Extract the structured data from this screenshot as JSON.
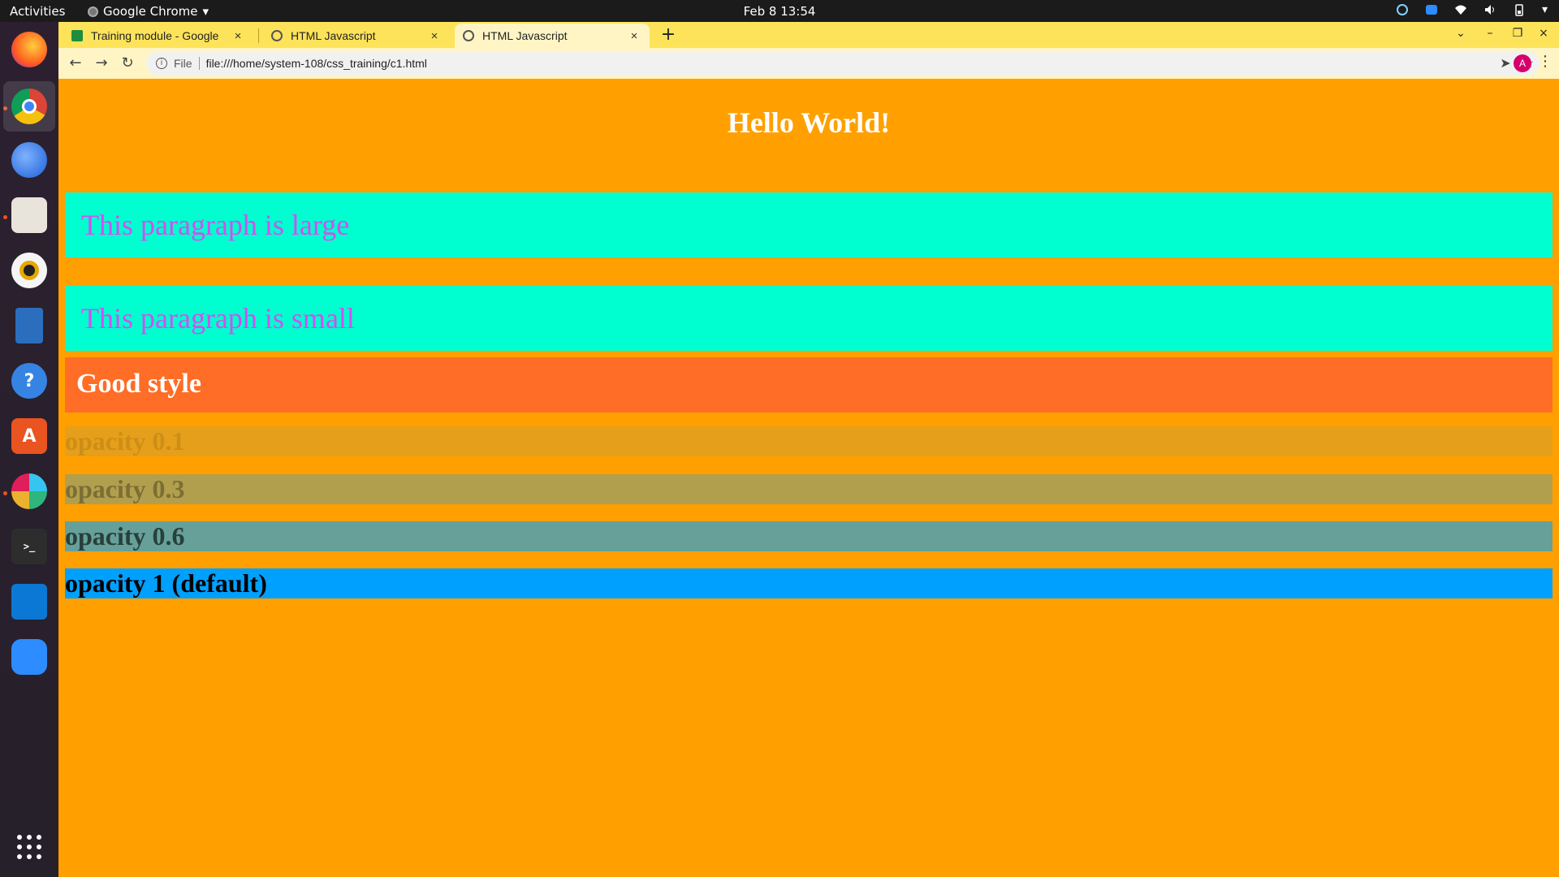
{
  "topbar": {
    "activities": "Activities",
    "app_name": "Google Chrome",
    "app_arrow": "▾",
    "clock": "Feb 8  13:54",
    "tray_arrow": "▾"
  },
  "dock": {
    "items": [
      "firefox-icon",
      "chrome-icon",
      "thunderbird-icon",
      "files-icon",
      "rhythmbox-icon",
      "writer-icon",
      "help-icon",
      "software-icon",
      "slack-icon",
      "terminal-icon",
      "vscode-icon",
      "zoom-icon"
    ],
    "apps_grid": "show-applications-icon"
  },
  "tabs": [
    {
      "title": "Training module - Google",
      "close": "×",
      "icon": "sheets-icon"
    },
    {
      "title": "HTML Javascript",
      "close": "×",
      "icon": "globe-icon"
    },
    {
      "title": "HTML Javascript",
      "close": "×",
      "icon": "globe-icon"
    }
  ],
  "newtab": "+",
  "window_controls": {
    "tablist": "⌄",
    "minimize": "–",
    "restore": "❐",
    "close": "×"
  },
  "toolbar": {
    "back": "←",
    "forward": "→",
    "reload": "↻",
    "scheme": "File",
    "url": "file:///home/system-108/css_training/c1.html",
    "share": "➤",
    "bookmark": "☆",
    "avatar": "A",
    "menu": "⋮"
  },
  "page": {
    "heading": "Hello World!",
    "para_large": "This paragraph is large",
    "para_small": "This paragraph is small",
    "good_style": "Good style",
    "opacity": [
      {
        "label": "opacity 0.1",
        "value": 0.1
      },
      {
        "label": "opacity 0.3",
        "value": 0.3
      },
      {
        "label": "opacity 0.6",
        "value": 0.6
      },
      {
        "label": "opacity 1 (default)",
        "value": 1
      }
    ]
  },
  "colors": {
    "page_bg": "#ffa000",
    "para_bg": "#00ffd0",
    "para_text": "#d050f0",
    "good_bg": "#ff6d26",
    "opacity_bg": "#00a0ff",
    "tabstrip": "#fde35a"
  }
}
